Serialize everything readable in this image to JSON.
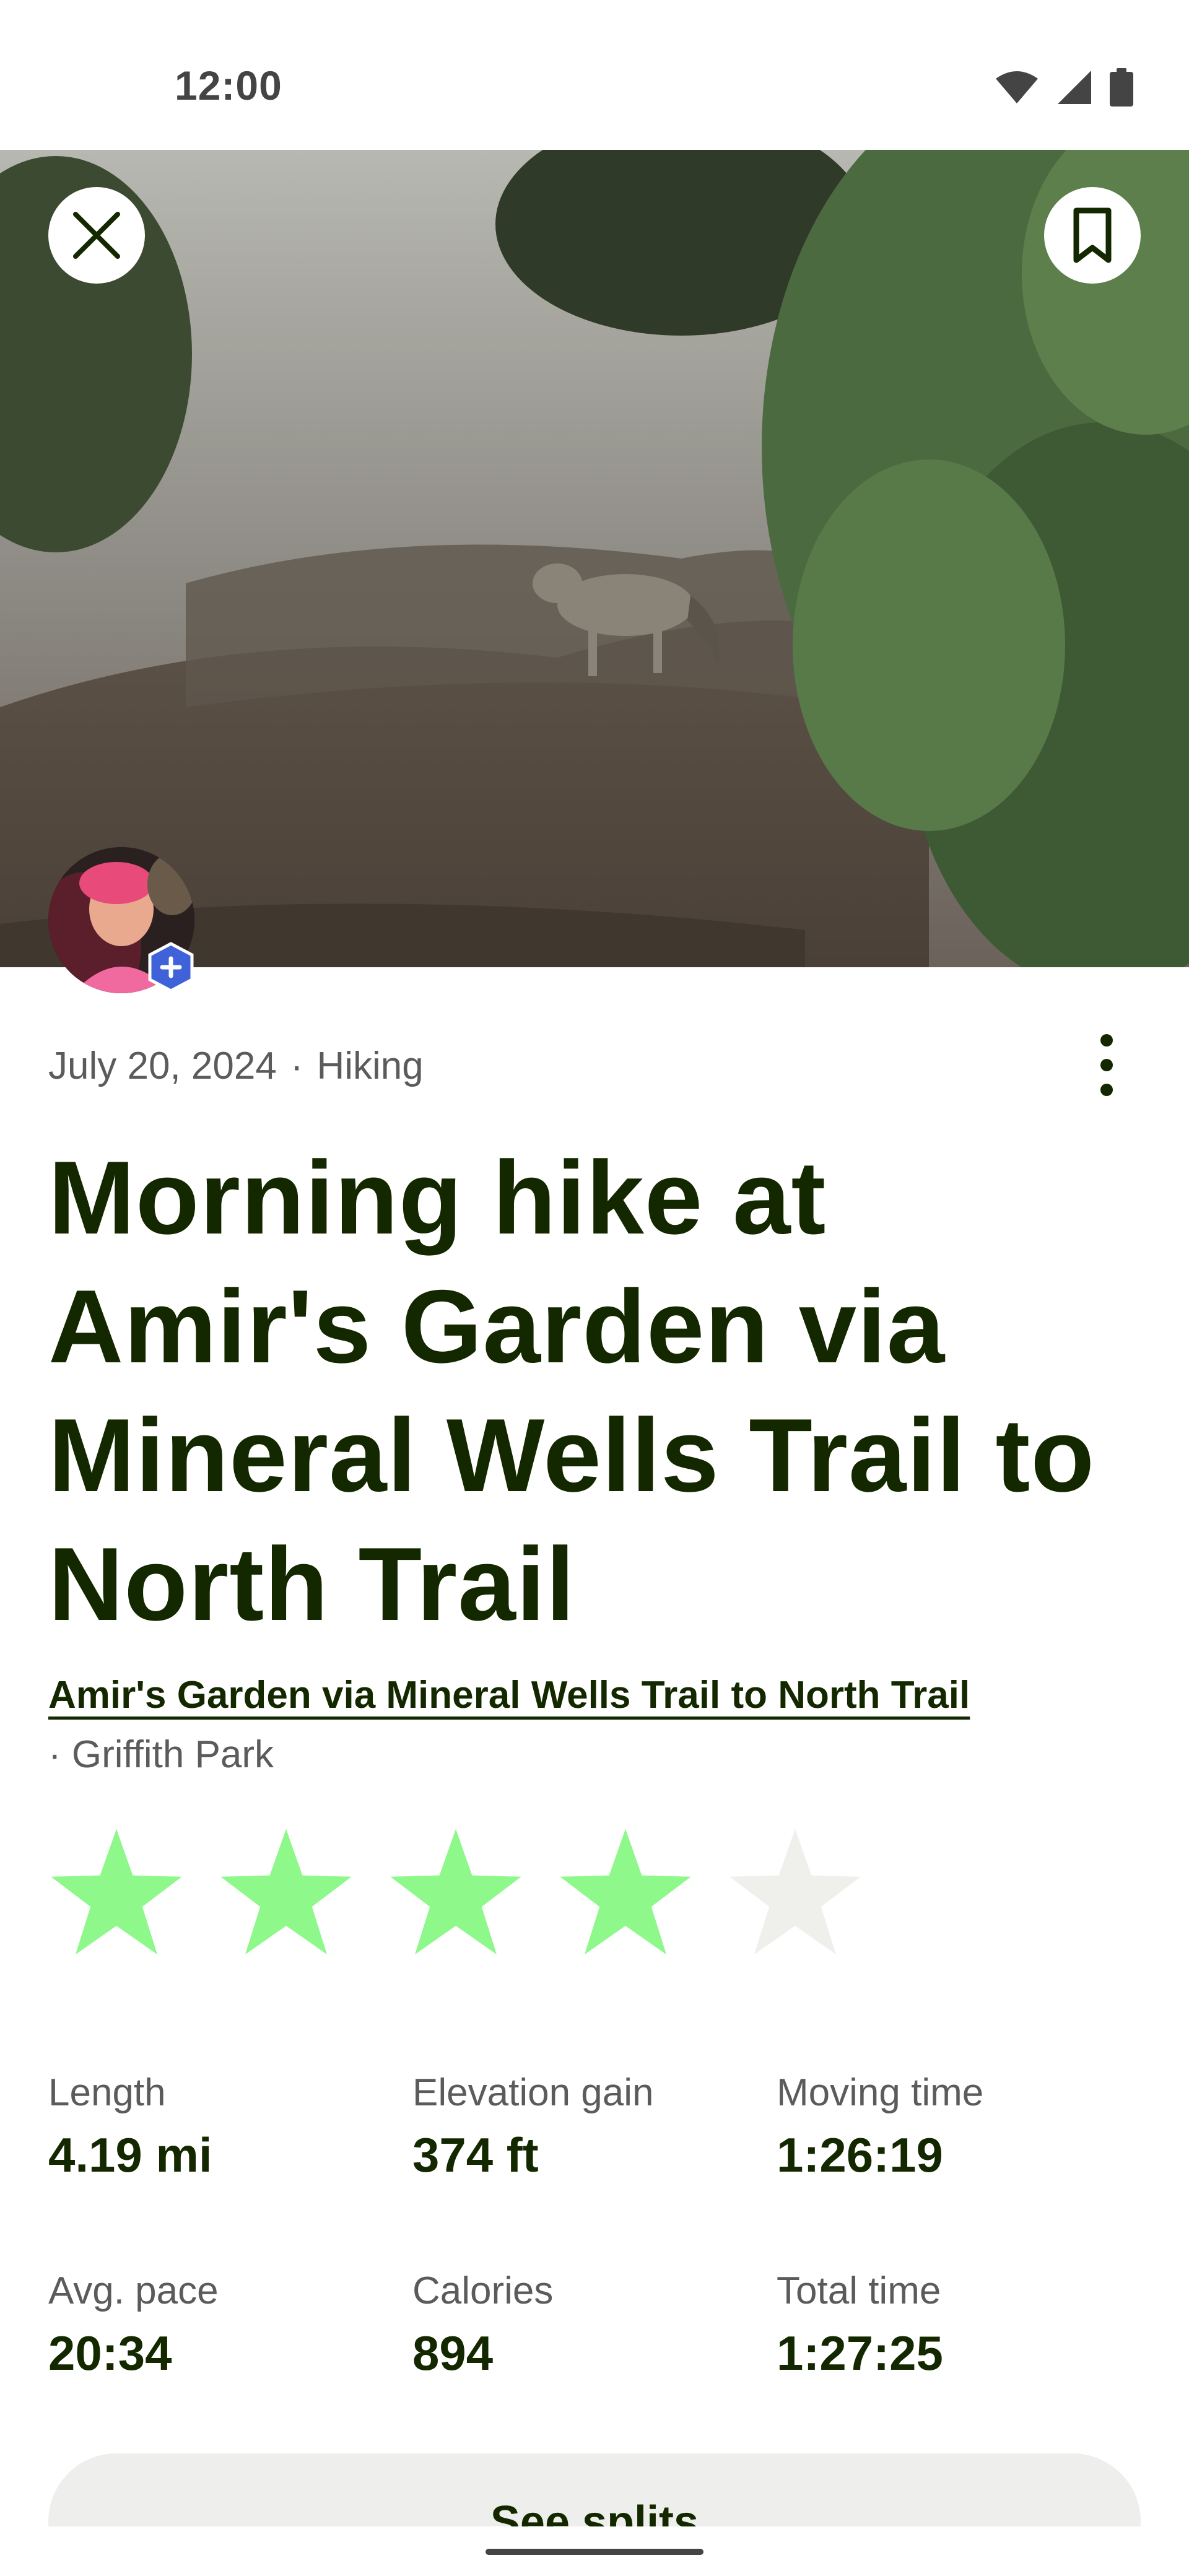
{
  "status_bar": {
    "time": "12:00",
    "icons": [
      "wifi-icon",
      "cellular-signal-icon",
      "battery-icon"
    ]
  },
  "hero": {
    "close_icon": "close-icon",
    "bookmark_icon": "bookmark-icon"
  },
  "activity": {
    "date": "July 20, 2024",
    "separator": "·",
    "type": "Hiking",
    "title": "Morning hike at Amir's Garden via Mineral Wells Trail to North Trail",
    "trail_name": "Amir's Garden via Mineral Wells Trail to North Trail",
    "park": "Griffith Park",
    "rating": 4,
    "rating_max": 5
  },
  "stats": [
    {
      "label": "Length",
      "value": "4.19 mi"
    },
    {
      "label": "Elevation gain",
      "value": "374 ft"
    },
    {
      "label": "Moving time",
      "value": "1:26:19"
    },
    {
      "label": "Avg. pace",
      "value": "20:34"
    },
    {
      "label": "Calories",
      "value": "894"
    },
    {
      "label": "Total time",
      "value": "1:27:25"
    }
  ],
  "splits_button": {
    "label": "See splits"
  },
  "colors": {
    "text_primary": "#142800",
    "text_secondary": "#5b5b5b",
    "star_filled": "#8ef88a",
    "star_empty": "#efefec",
    "button_bg": "#eeeeec"
  }
}
